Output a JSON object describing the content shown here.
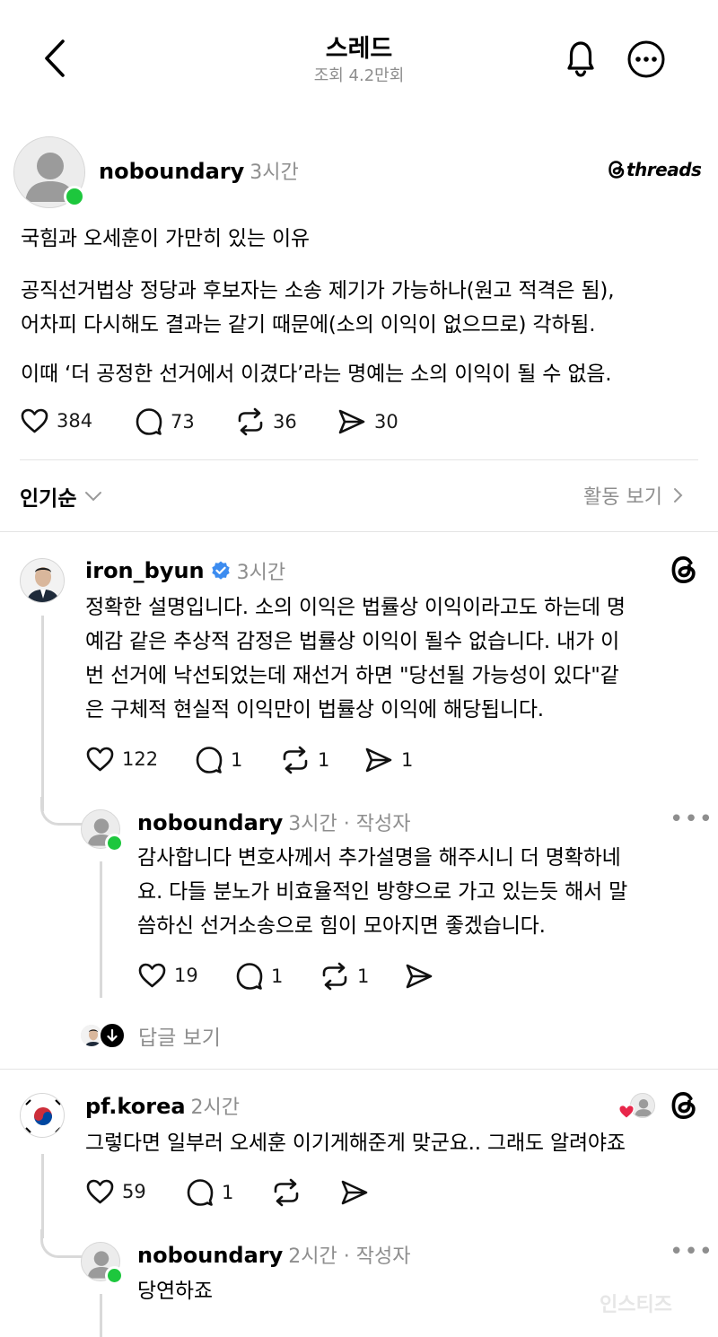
{
  "header": {
    "title": "스레드",
    "views": "조회 4.2만회"
  },
  "post": {
    "username": "noboundary",
    "time": "3시간",
    "brand": "threads",
    "lines": [
      "국힘과 오세훈이 가만히 있는 이유",
      "공직선거법상 정당과 후보자는 소송 제기가 가능하나(원고 적격은 됨),",
      "어차피 다시해도 결과는 같기 때문에(소의 이익이 없으므로) 각하됨.",
      "이때 ‘더 공정한 선거에서 이겼다’라는 명예는 소의 이익이 될 수 없음."
    ],
    "likes": "384",
    "replies": "73",
    "reposts": "36",
    "shares": "30"
  },
  "sort": {
    "label": "인기순",
    "activity": "활동 보기"
  },
  "comments": [
    {
      "username": "iron_byun",
      "time": "3시간",
      "lines": [
        "정확한 설명입니다. 소의 이익은  법률상 이익이라고도 하는데 명",
        "예감 같은 추상적 감정은 법률상 이익이 될수 없습니다. 내가 이",
        "번 선거에 낙선되었는데 재선거 하면 \"당선될 가능성이 있다\"같",
        "은 구체적 현실적 이익만이 법률상 이익에 해당됩니다."
      ],
      "likes": "122",
      "replies": "1",
      "reposts": "1",
      "shares": "1"
    },
    {
      "username": "noboundary",
      "time": "3시간 · 작성자",
      "lines": [
        "감사합니다 변호사께서 추가설명을 해주시니 더 명확하네",
        "요. 다들 분노가 비효율적인 방향으로 가고 있는듯 해서 말",
        "씀하신 선거소송으로 힘이 모아지면 좋겠습니다."
      ],
      "likes": "19",
      "replies": "1",
      "reposts": "1",
      "more": "•••"
    },
    {
      "view_replies": "답글 보기"
    },
    {
      "username": "pf.korea",
      "time": "2시간",
      "lines": [
        "그렇다면 일부러 오세훈 이기게해준게 맞군요.. 그래도 알려야죠"
      ],
      "likes": "59",
      "replies": "1"
    },
    {
      "username": "noboundary",
      "time": "2시간 · 작성자",
      "lines": [
        "당연하죠"
      ],
      "more": "•••"
    }
  ],
  "watermark": "인스티즈",
  "colors": {
    "online": "#1dc73d",
    "verified": "#3c8cf0",
    "heart_red": "#e8264a",
    "muted": "#8e8e8e"
  },
  "icons": [
    "back-icon",
    "bell-icon",
    "more-icon",
    "heart-icon",
    "comment-icon",
    "repost-icon",
    "share-icon",
    "threads-icon",
    "verified-icon",
    "chevron-down-icon",
    "chevron-right-icon"
  ]
}
